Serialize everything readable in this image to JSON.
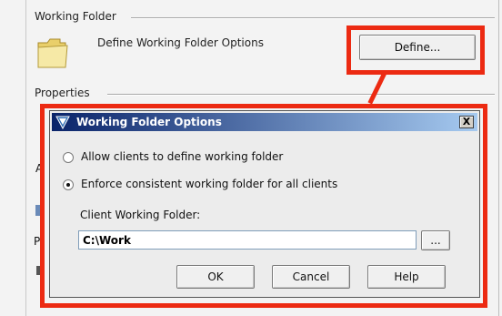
{
  "sections": {
    "working_folder": "Working Folder",
    "properties": "Properties"
  },
  "working_folder_row": {
    "description": "Define Working Folder Options",
    "define_button": "Define..."
  },
  "dialog": {
    "title": "Working Folder Options",
    "close_label": "X",
    "options": [
      {
        "label": "Allow clients to define working folder",
        "selected": false
      },
      {
        "label": "Enforce consistent working folder for all clients",
        "selected": true
      }
    ],
    "field_label": "Client Working Folder:",
    "field_value": "C:\\Work",
    "browse_label": "...",
    "buttons": {
      "ok": "OK",
      "cancel": "Cancel",
      "help": "Help"
    }
  },
  "background_fragments": {
    "a": "A",
    "p": "P"
  },
  "colors": {
    "highlight": "#ec2a12",
    "title_bar": "#0a246a"
  },
  "icons": [
    "folder-icon",
    "app-icon",
    "close-icon"
  ]
}
